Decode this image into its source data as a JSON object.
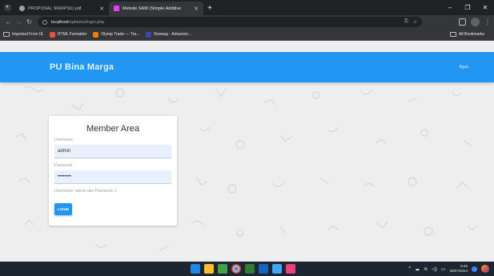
{
  "browser": {
    "tabs": [
      {
        "title": "PROPOSAL SKRIPSIU.pdf",
        "favicon_color": "#9aa0a6",
        "active": false
      },
      {
        "title": "Metode SAW (Simple Additive",
        "favicon_color": "#e040fb",
        "active": true
      }
    ],
    "address": {
      "host": "localhost",
      "path": "/spktebu/login.php"
    },
    "bookmarks": [
      {
        "label": "Imported From IE",
        "icon": "folder-icon"
      },
      {
        "label": "HTML Formatter",
        "icon_color": "#e8543b"
      },
      {
        "label": "Olymp Trade — Tra...",
        "icon_color": "#f57c00"
      },
      {
        "label": "Runway - Advancin...",
        "icon_color": "#3949ab"
      }
    ],
    "all_bookmarks_label": "All Bookmarks"
  },
  "appbar": {
    "brand": "PU Bina Marga",
    "user": "Agus"
  },
  "login": {
    "title": "Member Area",
    "username_label": "Username",
    "username_value": "admin",
    "password_label": "Password",
    "password_value": "password",
    "hint": "Username: admin dan Password: 1",
    "button_label": "LOGIN"
  },
  "taskbar": {
    "time": "8:45",
    "date": "30/07/2024",
    "apps": [
      "#1e88e5",
      "#fbc02d",
      "#43a047",
      "#e0e0e0",
      "#2e7d32",
      "#1565c0",
      "#42a5f5",
      "#ec407a"
    ]
  },
  "colors": {
    "accent": "#2196f3",
    "page_bg": "#eeeeee"
  }
}
